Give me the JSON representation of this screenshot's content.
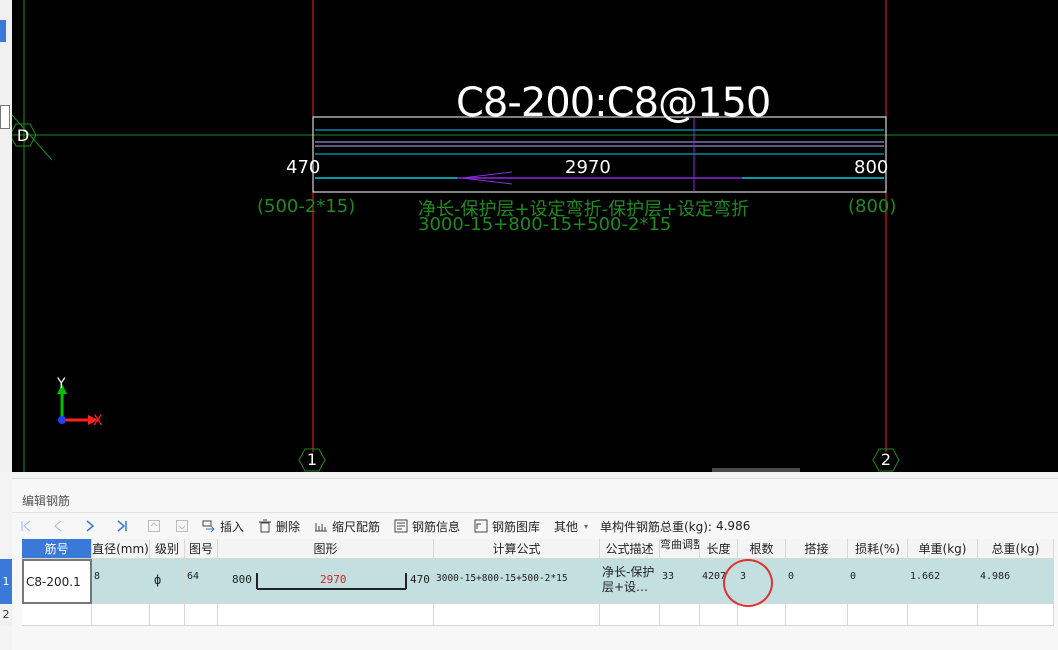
{
  "cad": {
    "title": "C8-200:C8@150",
    "dims": {
      "left": "470",
      "middle": "2970",
      "right": "800"
    },
    "notes": {
      "left": "(500-2*15)",
      "right": "(800)",
      "description": "净长-保护层+设定弯折-保护层+设定弯折",
      "formula": "3000-15+800-15+500-2*15"
    },
    "axis_bubbles": {
      "row": "D",
      "col1": "1",
      "col2": "2"
    },
    "ucs": {
      "y": "Y",
      "x": "X"
    },
    "colors": {
      "background": "#000000",
      "grid_red": "#ff2020",
      "grid_green": "#1f8a1f",
      "cyan": "#00d0e0",
      "purple": "#8a2be2"
    }
  },
  "panel": {
    "title": "编辑钢筋",
    "toolbar": {
      "nav_icons": [
        "first-icon",
        "prev-icon",
        "next-icon",
        "last-icon",
        "move-up-icon",
        "move-down-icon"
      ],
      "insert": "插入",
      "delete": "删除",
      "scale_rebar": "缩尺配筋",
      "rebar_info": "钢筋信息",
      "rebar_library": "钢筋图库",
      "other": "其他",
      "total_weight_label": "单构件钢筋总重(kg):",
      "total_weight_value": "4.986"
    },
    "table": {
      "headers": {
        "bar_no": "筋号",
        "diameter": "直径(mm)",
        "grade": "级别",
        "shape_no": "图号",
        "shape": "图形",
        "formula": "计算公式",
        "formula_desc": "公式描述",
        "bend_adjust": "弯曲调整",
        "length": "长度",
        "count": "根数",
        "lap": "搭接",
        "loss": "损耗(%)",
        "unit_weight": "单重(kg)",
        "total_weight": "总重(kg)"
      },
      "rows": [
        {
          "index": "1",
          "bar_no": "C8-200.1",
          "diameter": "8",
          "grade": "ф",
          "shape_no": "64",
          "shape_left": "800",
          "shape_mid": "2970",
          "shape_right": "470",
          "formula": "3000-15+800-15+500-2*15",
          "formula_desc": "净长-保护层+设…",
          "bend_adjust": "33",
          "length": "4207",
          "count": "3",
          "lap": "0",
          "loss": "0",
          "unit_weight": "1.662",
          "total_weight": "4.986"
        },
        {
          "index": "2"
        }
      ]
    }
  }
}
